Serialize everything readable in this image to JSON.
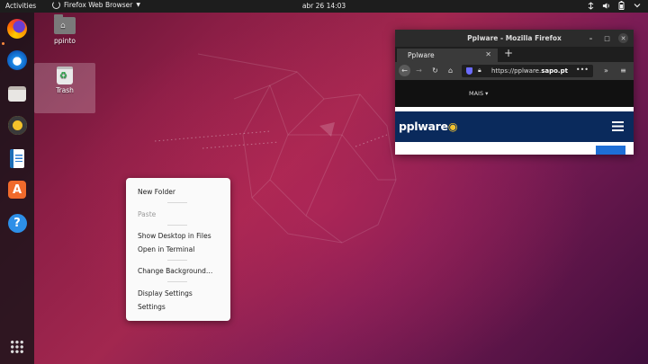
{
  "topbar": {
    "activities": "Activities",
    "app_name": "Firefox Web Browser",
    "clock": "abr 26  14:03",
    "tray_icons": [
      "network-icon",
      "volume-icon",
      "battery-icon",
      "system-menu-icon"
    ]
  },
  "dock": {
    "items": [
      "firefox-icon",
      "thunderbird-icon",
      "files-icon",
      "rhythmbox-icon",
      "libreoffice-writer-icon",
      "ubuntu-software-icon",
      "help-icon"
    ],
    "apps_grid": "show-applications-icon"
  },
  "desktop": {
    "icons": [
      {
        "label": "ppinto",
        "icon": "home-folder-icon"
      },
      {
        "label": "Trash",
        "icon": "trash-icon"
      }
    ]
  },
  "firefox": {
    "window_title": "Pplware - Mozilla Firefox",
    "tab_title": "Pplware",
    "new_tab": "+",
    "url_prefix": "https://pplware.",
    "url_bold": "sapo.pt",
    "page": {
      "nav_more": "MAIS",
      "logo_left": "ppl",
      "logo_right": "ware"
    }
  },
  "context_menu": {
    "items": [
      {
        "label": "New Folder",
        "enabled": true
      },
      {
        "label": "Paste",
        "enabled": false
      },
      {
        "label": "Show Desktop in Files",
        "enabled": true
      },
      {
        "label": "Open in Terminal",
        "enabled": true
      },
      {
        "label": "Change Background…",
        "enabled": true
      },
      {
        "label": "Display Settings",
        "enabled": true
      },
      {
        "label": "Settings",
        "enabled": true
      }
    ]
  },
  "colors": {
    "accent_orange": "#ff8a3d",
    "wallpaper_main": "#8c1e46",
    "pplware_header": "#0a2a5c"
  }
}
